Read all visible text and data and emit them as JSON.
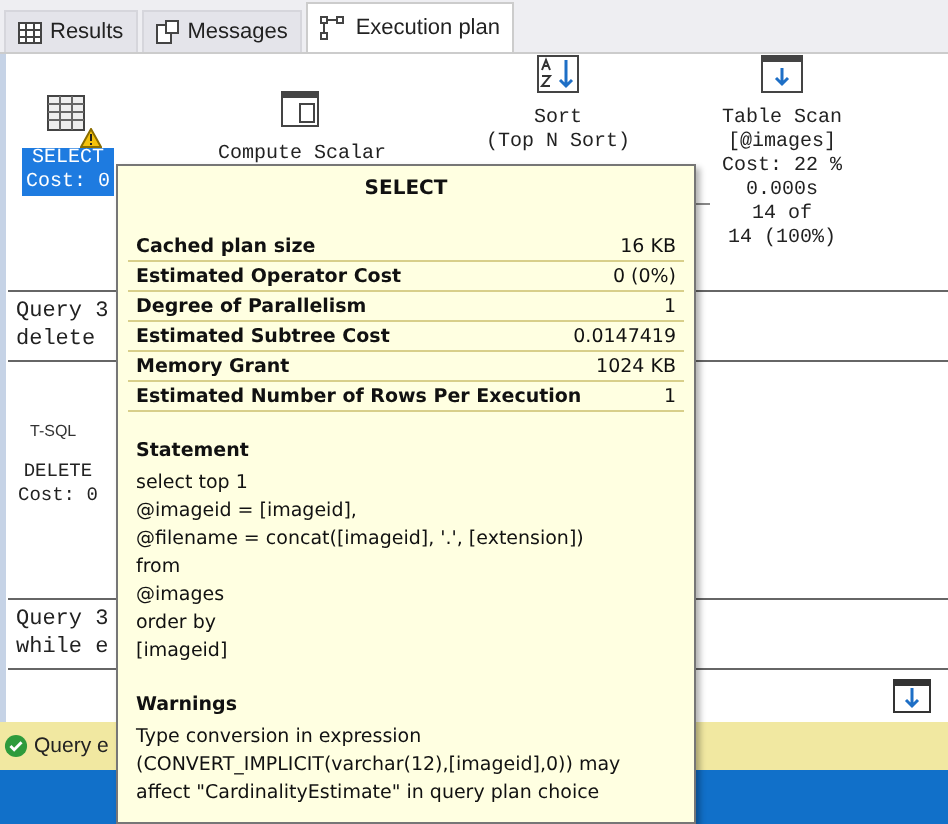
{
  "tabs": [
    {
      "label": "Results",
      "kind": "grid",
      "selected": false
    },
    {
      "label": "Messages",
      "kind": "messages",
      "selected": false
    },
    {
      "label": "Execution plan",
      "kind": "plan",
      "selected": true
    }
  ],
  "plan_nodes": [
    {
      "kind": "select",
      "lines": [
        "SELECT",
        "Cost: 0"
      ],
      "selected": true,
      "warning": true
    },
    {
      "kind": "compute",
      "lines": [
        "Compute Scalar"
      ],
      "selected": false,
      "warning": false
    },
    {
      "kind": "sort",
      "lines": [
        "Sort",
        "(Top N Sort)"
      ],
      "selected": false,
      "warning": false
    },
    {
      "kind": "scan",
      "lines": [
        "Table Scan",
        "[@images]",
        "Cost: 22 %",
        "0.000s",
        "14 of",
        "14 (100%)"
      ],
      "selected": false,
      "warning": false
    }
  ],
  "query_1": {
    "lines": [
      "Query 3",
      "delete"
    ]
  },
  "node_2": {
    "label": "T-SQL",
    "lines": [
      "DELETE",
      "Cost: 0"
    ]
  },
  "query_2": {
    "lines": [
      "Query 3",
      "while e"
    ]
  },
  "status_bar": {
    "text": "Query e"
  },
  "tooltip": {
    "title": "SELECT",
    "properties": [
      {
        "name": "Cached plan size",
        "value": "16 KB"
      },
      {
        "name": "Estimated Operator Cost",
        "value": "0 (0%)"
      },
      {
        "name": "Degree of Parallelism",
        "value": "1"
      },
      {
        "name": "Estimated Subtree Cost",
        "value": "0.0147419"
      },
      {
        "name": "Memory Grant",
        "value": "1024 KB"
      },
      {
        "name": "Estimated Number of Rows Per Execution",
        "value": "1"
      }
    ],
    "statement_heading": "Statement",
    "statement_lines": [
      "select top 1",
      "@imageid = [imageid],",
      "@filename = concat([imageid], '.', [extension])",
      "from",
      "@images",
      "order by",
      "[imageid]"
    ],
    "warnings_heading": "Warnings",
    "warnings_text": "Type conversion in expression (CONVERT_IMPLICIT(varchar(12),[imageid],0)) may affect \"CardinalityEstimate\" in query plan choice"
  }
}
